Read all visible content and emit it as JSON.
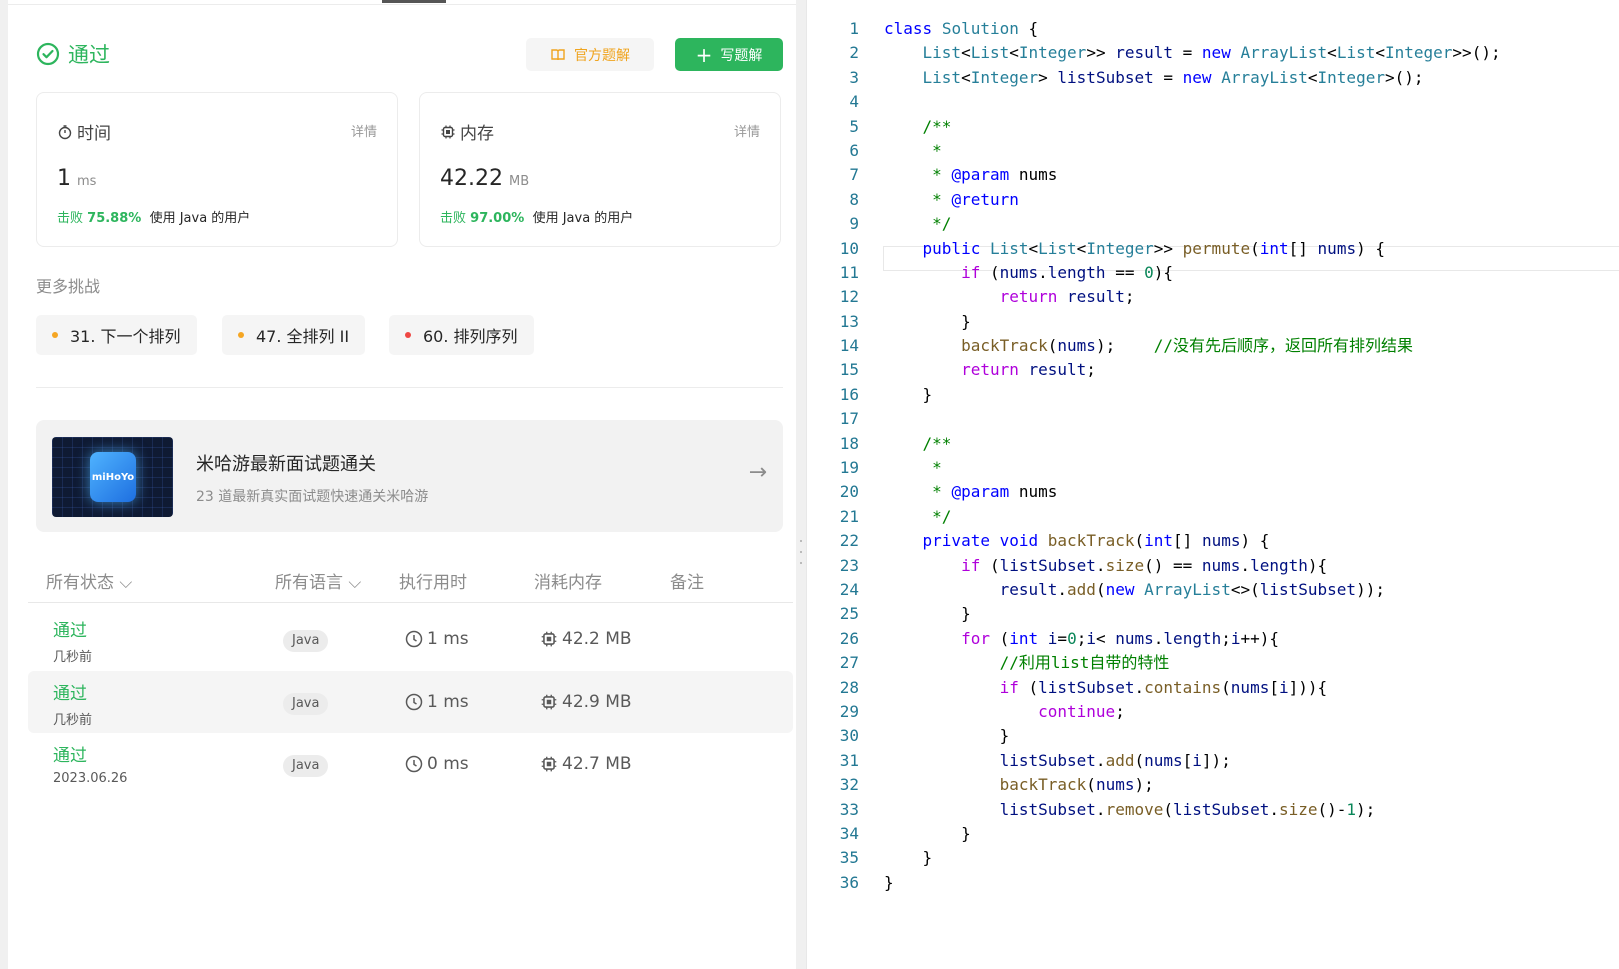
{
  "status": {
    "label": "通过",
    "color": "#2db55d"
  },
  "buttons": {
    "official": "官方题解",
    "write": "写题解"
  },
  "runtime": {
    "title": "时间",
    "detail": "详情",
    "value": "1",
    "unit": "ms",
    "beats_prefix": "击败",
    "beats": "75.88%",
    "beats_suffix": "使用 Java 的用户"
  },
  "memory": {
    "title": "内存",
    "detail": "详情",
    "value": "42.22",
    "unit": "MB",
    "beats_prefix": "击败",
    "beats": "97.00%",
    "beats_suffix": "使用 Java 的用户"
  },
  "more": {
    "title": "更多挑战",
    "tags": [
      {
        "label": "31. 下一个排列",
        "color": "#f5a623"
      },
      {
        "label": "47. 全排列 II",
        "color": "#f5a623"
      },
      {
        "label": "60. 排列序列",
        "color": "#ef4743"
      }
    ]
  },
  "promo": {
    "logo_text": "miHoYo",
    "title": "米哈游最新面试题通关",
    "subtitle": "23 道最新真实面试题快速通关米哈游"
  },
  "table": {
    "headers": {
      "status": "所有状态",
      "lang": "所有语言",
      "runtime": "执行用时",
      "memory": "消耗内存",
      "notes": "备注"
    },
    "rows": [
      {
        "status": "通过",
        "time": "几秒前",
        "lang": "Java",
        "runtime": "1 ms",
        "memory": "42.2 MB"
      },
      {
        "status": "通过",
        "time": "几秒前",
        "lang": "Java",
        "runtime": "1 ms",
        "memory": "42.9 MB"
      },
      {
        "status": "通过",
        "time": "2023.06.26",
        "lang": "Java",
        "runtime": "0 ms",
        "memory": "42.7 MB"
      }
    ]
  },
  "editor": {
    "current_line": 11,
    "lines": [
      "class Solution {",
      "    List<List<Integer>> result = new ArrayList<List<Integer>>();",
      "    List<Integer> listSubset = new ArrayList<Integer>();",
      "",
      "    /**",
      "     *",
      "     * @param nums",
      "     * @return",
      "     */",
      "    public List<List<Integer>> permute(int[] nums) {",
      "        if (nums.length == 0){",
      "            return result;",
      "        }",
      "        backTrack(nums);    //没有先后顺序，返回所有排列结果",
      "        return result;",
      "    }",
      "",
      "    /**",
      "     *",
      "     * @param nums",
      "     */",
      "    private void backTrack(int[] nums) {",
      "        if (listSubset.size() == nums.length){",
      "            result.add(new ArrayList<>(listSubset));",
      "        }",
      "        for (int i=0;i< nums.length;i++){",
      "            //利用list自带的特性",
      "            if (listSubset.contains(nums[i])){",
      "                continue;",
      "            }",
      "            listSubset.add(nums[i]);",
      "            backTrack(nums);",
      "            listSubset.remove(listSubset.size()-1);",
      "        }",
      "    }",
      "}"
    ]
  }
}
